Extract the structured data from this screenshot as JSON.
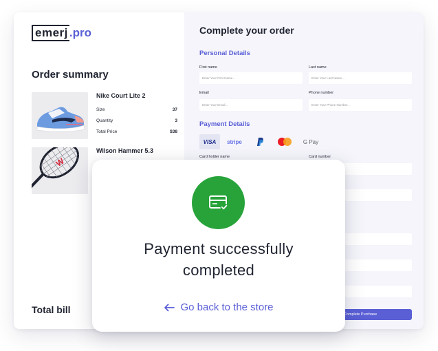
{
  "brand": {
    "logo_main": "emerj",
    "logo_accent": ".pro"
  },
  "order_summary": {
    "title": "Order summary",
    "items": [
      {
        "name": "Nike Court Lite 2",
        "rows": [
          {
            "label": "Size",
            "value": "37"
          },
          {
            "label": "Quantity",
            "value": "3"
          },
          {
            "label": "Total Price",
            "value": "$38"
          }
        ]
      },
      {
        "name": "Wilson Hammer 5.3"
      }
    ],
    "total_label": "Total bill"
  },
  "checkout": {
    "title": "Complete your order",
    "personal_details": "Personal Details",
    "fields": {
      "first_name": {
        "label": "First name",
        "placeholder": "Enter Your First Name..."
      },
      "last_name": {
        "label": "Last name",
        "placeholder": "Enter Your Last Name..."
      },
      "email": {
        "label": "Email",
        "placeholder": "Enter Your Email..."
      },
      "phone": {
        "label": "Phone number",
        "placeholder": "Enter Your Phone Number..."
      },
      "card_holder": {
        "label": "Card holder name"
      },
      "card_number": {
        "label": "Card number"
      }
    },
    "payment_details": "Payment Details",
    "payment_methods": [
      "VISA",
      "stripe",
      "PayPal",
      "Mastercard",
      "G Pay"
    ],
    "purchase_button": "Complete Purchase"
  },
  "modal": {
    "message_line1": "Payment successfully",
    "message_line2": "completed",
    "back_link": "Go back to the store",
    "icon": "payment-card-check-icon",
    "success_color": "#27a33a"
  },
  "colors": {
    "accent": "#5a5fd6",
    "text": "#1f2330",
    "form_bg": "#f5f5fb"
  }
}
